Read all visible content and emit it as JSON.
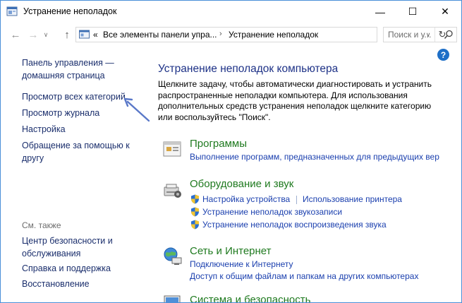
{
  "window": {
    "title": "Устранение неполадок",
    "minimize": "—",
    "maximize": "☐",
    "close": "✕"
  },
  "nav": {
    "back": "←",
    "forward": "→",
    "dropdown": "∨",
    "up": "↑"
  },
  "address": {
    "prefix": "«",
    "crumbs": [
      "Все элементы панели упра...",
      "Устранение неполадок"
    ],
    "chevron": "›",
    "dropdown": "∨",
    "refresh": "↻"
  },
  "search": {
    "placeholder": "Поиск и у..."
  },
  "help": "?",
  "sidebar": {
    "home_line1": "Панель управления —",
    "home_line2": "домашняя страница",
    "items": [
      "Просмотр всех категорий",
      "Просмотр журнала",
      "Настройка"
    ],
    "help_line1": "Обращение за помощью к",
    "help_line2": "другу",
    "see_also": "См. также",
    "security_line1": "Центр безопасности и",
    "security_line2": "обслуживания",
    "support": "Справка и поддержка",
    "recovery": "Восстановление"
  },
  "main": {
    "title": "Устранение неполадок компьютера",
    "description": "Щелкните задачу, чтобы автоматически диагностировать и устранить распространенные неполадки компьютера. Для использования дополнительных средств устранения неполадок щелкните категорию или воспользуйтесь \"Поиск\".",
    "categories": [
      {
        "title": "Программы",
        "links": [
          "Выполнение программ, предназначенных для предыдущих вер"
        ]
      },
      {
        "title": "Оборудование и звук",
        "links": [
          "Настройка устройства",
          "Использование принтера",
          "Устранение неполадок звукозаписи",
          "Устранение неполадок воспроизведения звука"
        ]
      },
      {
        "title": "Сеть и Интернет",
        "links": [
          "Подключение к Интернету",
          "Доступ к общим файлам и папкам на других компьютерах"
        ]
      },
      {
        "title": "Система и безопасность",
        "links": []
      }
    ]
  },
  "colors": {
    "category": "#1f7a1f",
    "link": "#1a3fae",
    "nav_link": "#1a2e6c",
    "title": "#1e3287",
    "annotation_arrow": "#5a78c8"
  }
}
